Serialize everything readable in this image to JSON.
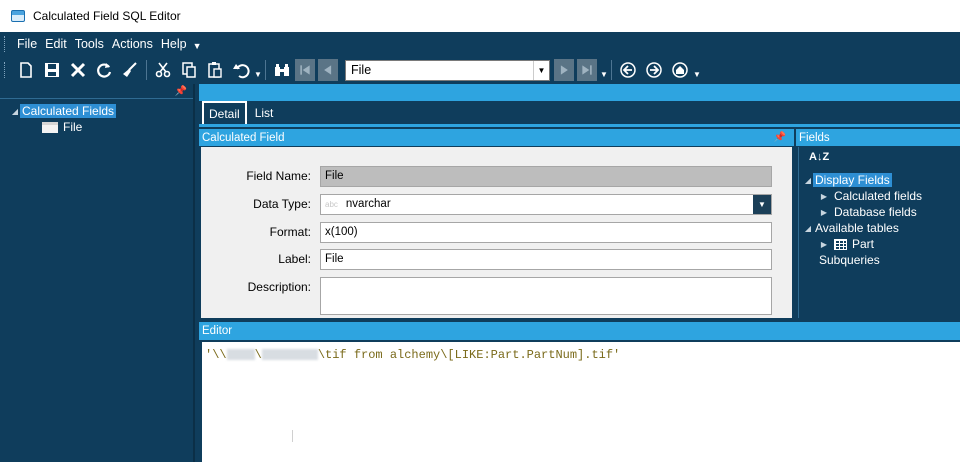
{
  "window": {
    "title": "Calculated Field SQL Editor"
  },
  "menu": {
    "items": [
      "File",
      "Edit",
      "Tools",
      "Actions",
      "Help"
    ]
  },
  "toolbar": {
    "combo_value": "File",
    "icons": [
      "new-icon",
      "save-icon",
      "delete-icon",
      "refresh-icon",
      "clear-icon",
      "cut-icon",
      "copy-icon",
      "paste-icon",
      "undo-icon",
      "search-icon",
      "first-icon",
      "previous-icon",
      "next-icon",
      "last-icon",
      "back-icon",
      "forward-icon",
      "home-icon"
    ]
  },
  "left_tree": {
    "root": "Calculated Fields",
    "children": [
      "File"
    ]
  },
  "tabs": [
    "Detail",
    "List"
  ],
  "calculated_field": {
    "header": "Calculated Field",
    "field_name_label": "Field Name:",
    "field_name_value": "File",
    "data_type_label": "Data Type:",
    "data_type_prefix": "abc",
    "data_type_value": "nvarchar",
    "format_label": "Format:",
    "format_value": "x(100)",
    "label_label": "Label:",
    "label_value": "File",
    "description_label": "Description:",
    "description_value": ""
  },
  "fields_panel": {
    "header": "Fields",
    "sort_label": "A↓Z",
    "display_fields": "Display Fields",
    "calculated_fields": "Calculated fields",
    "database_fields": "Database fields",
    "available_tables": "Available tables",
    "table_part": "Part",
    "subqueries": "Subqueries"
  },
  "editor": {
    "header": "Editor",
    "code_prefix": "'\\\\",
    "code_sep": "\\",
    "code_suffix": "\\tif from alchemy\\[LIKE:Part.PartNum].tif'"
  }
}
